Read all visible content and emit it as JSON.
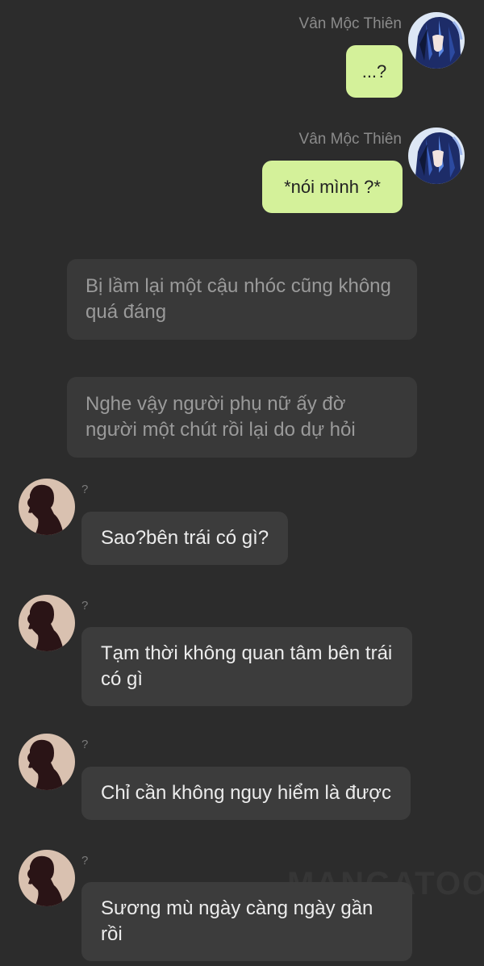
{
  "messages": [
    {
      "sender": "Vân Mộc Thiên",
      "text": "...?"
    },
    {
      "sender": "Vân Mộc Thiên",
      "text": "*nói mình ?*"
    },
    {
      "narration": "Bị lầm lại một cậu nhóc cũng không quá đáng"
    },
    {
      "narration": "Nghe vậy người phụ nữ ấy đờ người một chút rồi lại do dự hỏi"
    },
    {
      "sender": "?",
      "text": "Sao?bên trái có gì?"
    },
    {
      "sender": "?",
      "text": "Tạm thời không quan tâm bên trái có gì"
    },
    {
      "sender": "?",
      "text": "Chỉ cần không nguy hiểm là được"
    },
    {
      "sender": "?",
      "text": "Sương mù ngày càng ngày gần rồi"
    }
  ],
  "watermark": "MANGATOON",
  "icons": {
    "outgoing_avatar": "anime-avatar-icon",
    "incoming_avatar": "silhouette-avatar-icon"
  },
  "colors": {
    "background": "#2c2c2c",
    "outgoing_bubble": "#d4f19a",
    "incoming_bubble": "#3c3c3c",
    "narration_bubble": "#393939"
  }
}
